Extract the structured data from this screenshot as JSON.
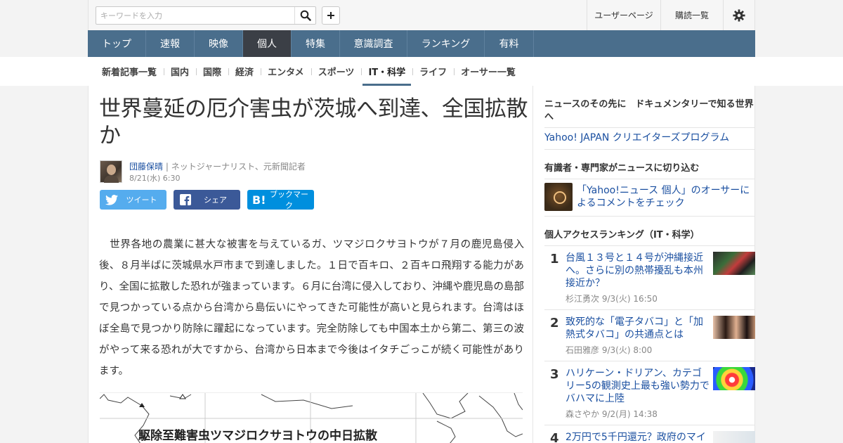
{
  "search": {
    "placeholder": "キーワードを入力"
  },
  "top_links": {
    "user_page": "ユーザーページ",
    "subscriptions": "購読一覧"
  },
  "nav": [
    "トップ",
    "速報",
    "映像",
    "個人",
    "特集",
    "意識調査",
    "ランキング",
    "有料"
  ],
  "subnav": [
    "新着記事一覧",
    "国内",
    "国際",
    "経済",
    "エンタメ",
    "スポーツ",
    "IT・科学",
    "ライフ",
    "オーサー一覧"
  ],
  "article": {
    "title": "世界蔓延の厄介害虫が茨城へ到達、全国拡散か",
    "author": "団藤保晴",
    "author_role": "| ネットジャーナリスト、元新聞記者",
    "date": "8/21(水) 6:30",
    "share": {
      "tweet": "ツイート",
      "facebook": "シェア",
      "bookmark": "ブックマーク"
    },
    "body": "　世界各地の農業に甚大な被害を与えているガ、ツマジロクサヨトウが７月の鹿児島侵入後、８月半ばに茨城県水戸市まで到達しました。１日で百キロ、２百キロ飛翔する能力があり、全国に拡散した恐れが強まっています。６月に台湾に侵入しており、沖縄や鹿児島の島部で見つかっている点から台湾から島伝いにやってきた可能性が高いと見られます。台湾はほぼ全島で見つかり防除に躍起になっています。完全防除しても中国本土から第二、第三の波がやって来る恐れが大ですから、台湾から日本まで今後はイタチごっこが続く可能性があります。",
    "map_title": "駆除至難害虫ツマジロクサヨトウの中日拡散"
  },
  "sidebar": {
    "promo_head": "ニュースのその先に　ドキュメンタリーで知る世界へ",
    "promo_link": "Yahoo! JAPAN クリエイターズプログラム",
    "expert_head": "有識者・専門家がニュースに切り込む",
    "expert_link": "「Yahoo!ニュース 個人」のオーサーによるコメントをチェック",
    "ranking_head": "個人アクセスランキング（IT・科学）",
    "ranking": [
      {
        "num": "1",
        "title": "台風１３号と１４号が沖縄接近へ。さらに別の熱帯擾乱も本州接近か？",
        "author": "杉江勇次",
        "date": "9/3(火) 16:50"
      },
      {
        "num": "2",
        "title": "致死的な「電子タバコ」と「加熱式タバコ」の共通点とは",
        "author": "石田雅彦",
        "date": "9/3(火) 8:00"
      },
      {
        "num": "3",
        "title": "ハリケーン・ドリアン、カテゴリー5の観測史上最も強い勢力でバハマに上陸",
        "author": "森さやか",
        "date": "9/2(月) 14:38"
      },
      {
        "num": "4",
        "title": "2万円で5千円還元？政府のマイ"
      }
    ]
  }
}
